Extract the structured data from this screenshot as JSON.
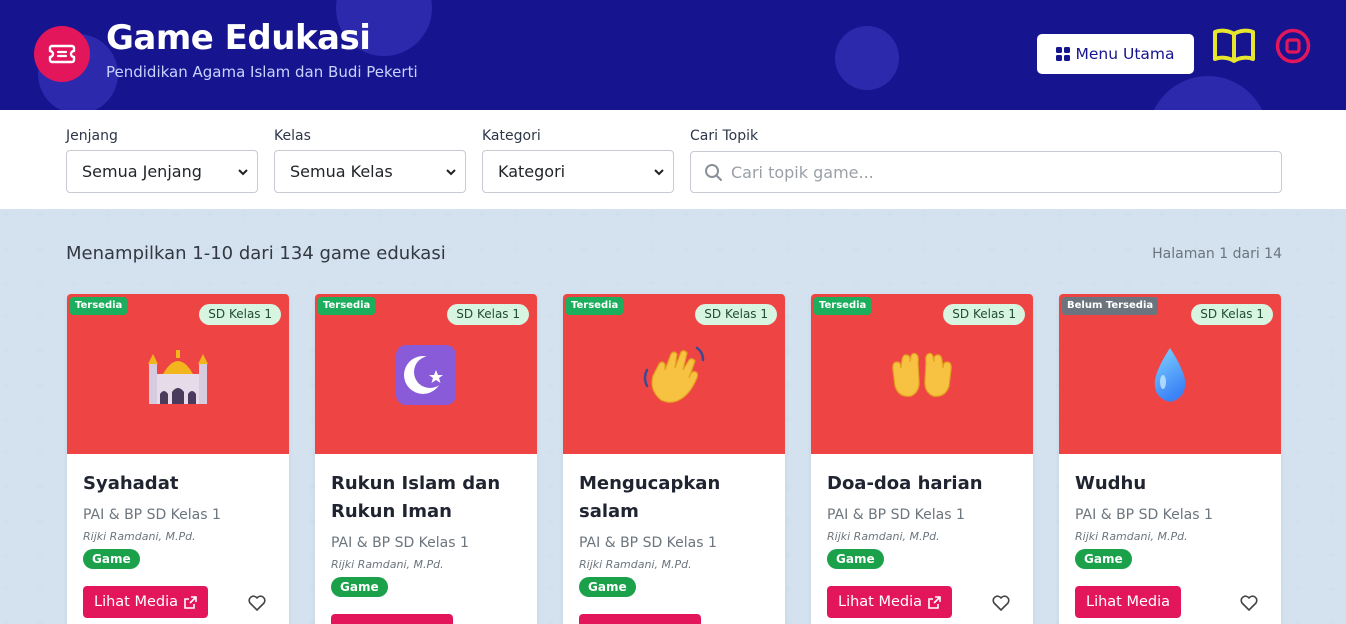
{
  "header": {
    "title": "Game Edukasi",
    "subtitle": "Pendidikan Agama Islam dan Budi Pekerti",
    "menu_label": "Menu Utama",
    "logo_icon": "ticket-icon",
    "book_icon": "book-icon",
    "stop_icon": "stop-circle-icon",
    "colors": {
      "bg": "#16148f",
      "accent": "#e3165b",
      "book": "#e6e62e"
    }
  },
  "filters": {
    "jenjang": {
      "label": "Jenjang",
      "value": "Semua Jenjang"
    },
    "kelas": {
      "label": "Kelas",
      "value": "Semua Kelas"
    },
    "kategori": {
      "label": "Kategori",
      "value": "Kategori"
    },
    "search": {
      "label": "Cari Topik",
      "placeholder": "Cari topik game..."
    }
  },
  "results": {
    "summary": "Menampilkan 1-10 dari 134 game edukasi",
    "page": "Halaman 1 dari 14"
  },
  "cards": [
    {
      "status": "Tersedia",
      "grade": "SD Kelas 1",
      "icon": "mosque-icon",
      "title": "Syahadat",
      "subject": "PAI & BP SD Kelas 1",
      "author": "Rijki Ramdani, M.Pd.",
      "badge": "Game",
      "button": "Lihat Media",
      "external": true
    },
    {
      "status": "Tersedia",
      "grade": "SD Kelas 1",
      "icon": "star-and-crescent-icon",
      "title": "Rukun Islam dan Rukun Iman",
      "subject": "PAI & BP SD Kelas 1",
      "author": "Rijki Ramdani, M.Pd.",
      "badge": "Game",
      "button": "",
      "external": false
    },
    {
      "status": "Tersedia",
      "grade": "SD Kelas 1",
      "icon": "waving-hand-icon",
      "title": "Mengucapkan salam",
      "subject": "PAI & BP SD Kelas 1",
      "author": "Rijki Ramdani, M.Pd.",
      "badge": "Game",
      "button": "",
      "external": false
    },
    {
      "status": "Tersedia",
      "grade": "SD Kelas 1",
      "icon": "palms-up-icon",
      "title": "Doa-doa harian",
      "subject": "PAI & BP SD Kelas 1",
      "author": "Rijki Ramdani, M.Pd.",
      "badge": "Game",
      "button": "Lihat Media",
      "external": true
    },
    {
      "status": "Belum Tersedia",
      "grade": "SD Kelas 1",
      "icon": "droplet-icon",
      "title": "Wudhu",
      "subject": "PAI & BP SD Kelas 1",
      "author": "Rijki Ramdani, M.Pd.",
      "badge": "Game",
      "button": "Lihat Media",
      "external": false
    }
  ]
}
